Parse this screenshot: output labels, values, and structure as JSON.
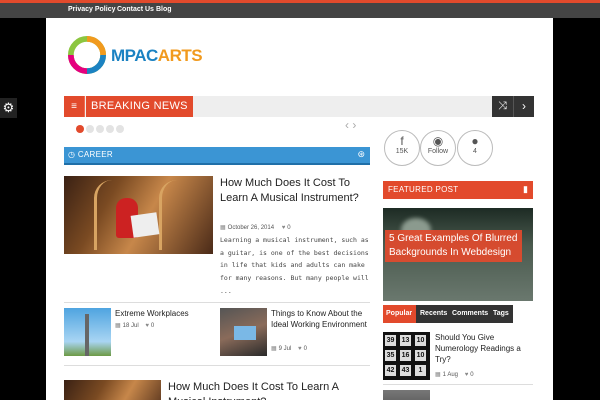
{
  "topnav": {
    "items": [
      "Privacy Policy",
      "Contact Us",
      "Blog"
    ]
  },
  "site": {
    "logo_text_a": "MPAC",
    "logo_text_b": "ARTS"
  },
  "breaking": {
    "label": "BREAKING NEWS",
    "menu_glyph": "≡",
    "shuffle_glyph": "⤨",
    "next_glyph": "›"
  },
  "slider": {
    "prev_glyph": "‹",
    "next_glyph": "›"
  },
  "career": {
    "label": "CAREER",
    "icon_glyph": "◷",
    "rss_glyph": "⊛"
  },
  "main_post": {
    "title": "How Much Does It Cost To Learn A Musical Instrument?",
    "date": "October 26, 2014",
    "likes": "0",
    "excerpt": "Learning a musical instrument, such as a guitar, is one of the best decisions in life that kids and adults can make for many reasons. But many people will ..."
  },
  "small_posts": [
    {
      "title": "Extreme Workplaces",
      "date": "18 Jul",
      "likes": "0"
    },
    {
      "title": "Things to Know About the Ideal Working Environment",
      "date": "9 Jul",
      "likes": "0"
    }
  ],
  "bottom_post": {
    "title": "How Much Does It Cost To Learn A Musical Instrument?"
  },
  "social": [
    {
      "glyph": "f",
      "count": "15K"
    },
    {
      "glyph": "◉",
      "count": "Follow"
    },
    {
      "glyph": "●",
      "count": "4"
    }
  ],
  "featured": {
    "label": "FEATURED POST",
    "bookmark_glyph": "▮",
    "title": "5 Great Examples Of Blurred Backgrounds In Webdesign"
  },
  "tabs": [
    "Popular",
    "Recents",
    "Comments",
    "Tags"
  ],
  "side_posts": [
    {
      "title": "Should You Give Numerology Readings a Try?",
      "date": "1 Aug",
      "likes": "0"
    }
  ],
  "numerology_digits": [
    "39",
    "13",
    "10",
    "35",
    "16",
    "10",
    "42",
    "43",
    "1"
  ],
  "icons": {
    "gear": "⚙",
    "calendar": "▦",
    "heart": "♥"
  },
  "colors": {
    "accent": "#e24a2c",
    "career": "#3b95d4",
    "dark": "#333333"
  }
}
